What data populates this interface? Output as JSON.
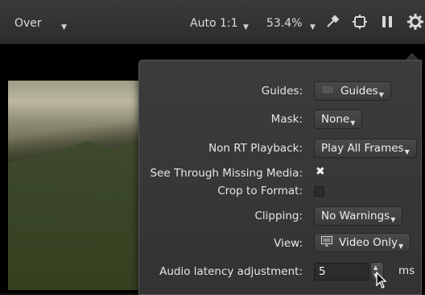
{
  "toolbar": {
    "composite_mode": "Over",
    "zoom_mode": "Auto 1:1",
    "zoom_percent": "53.4%",
    "icons": [
      "eyedropper-icon",
      "overlay-icon",
      "pause-icon",
      "gear-icon"
    ]
  },
  "settings": {
    "guides_label": "Guides:",
    "guides_value": "Guides",
    "mask_label": "Mask:",
    "mask_value": "None",
    "non_rt_label": "Non RT Playback:",
    "non_rt_value": "Play All Frames",
    "see_through_label": "See Through Missing Media:",
    "see_through_checked": true,
    "crop_label": "Crop to Format:",
    "crop_checked": false,
    "clipping_label": "Clipping:",
    "clipping_value": "No Warnings",
    "view_label": "View:",
    "view_value": "Video Only",
    "audio_latency_label": "Audio latency adjustment:",
    "audio_latency_value": "5",
    "audio_latency_unit": "ms"
  }
}
